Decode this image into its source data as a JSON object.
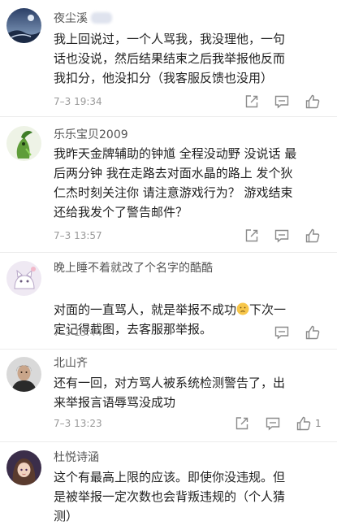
{
  "colors": {
    "text_primary": "#222222",
    "text_username": "#555555",
    "text_meta": "#999999",
    "divider": "#ececec",
    "icon": "#8a8a8a"
  },
  "comments": [
    {
      "username": "夜尘溪",
      "avatar_icon": "avatar-night-scene",
      "body": "我上回说过，一个人骂我，我没理他，一句\n话也没说，然后结果结束之后我举报他反而\n我扣分，他没扣分（我客服反馈也没用）",
      "timestamp": "7–3 19:34",
      "actions": [
        "share-icon",
        "comment-icon",
        "like-icon"
      ]
    },
    {
      "username": "乐乐宝贝2009",
      "avatar_icon": "avatar-green-character",
      "body": "我昨天金牌辅助的钟馗 全程没动野 没说话 最\n后两分钟 我在走路去对面水晶的路上 发个狄\n仁杰时刻关注你 请注意游戏行为？ 游戏结束\n还给我发个了警告邮件？",
      "timestamp": "7–3 13:57",
      "actions": [
        "share-icon",
        "comment-icon",
        "like-icon"
      ]
    },
    {
      "username": "晚上睡不着就改了个名字的酷酷",
      "avatar_icon": "avatar-cat-illustration",
      "body_line1_before": "对面的一直骂人，就是举报不成功",
      "emoji_icon": "sad-face-emoji-icon",
      "body_line1_after": "下次一",
      "body_line2": "定记得截图，去客服那举报。",
      "timestamp": "7–3 13:44",
      "actions": [
        "comment-icon",
        "like-icon"
      ]
    },
    {
      "username": "北山齐",
      "avatar_icon": "avatar-man-portrait",
      "body": "还有一回，对方骂人被系统检测警告了，出\n来举报言语辱骂没成功",
      "timestamp": "7–3 13:23",
      "like_count": "1",
      "actions": [
        "share-icon",
        "comment-icon",
        "like-icon"
      ]
    },
    {
      "username": "杜悦诗涵",
      "avatar_icon": "avatar-anime-girl",
      "body": "这个有最高上限的应该。即使你没违规。但\n是被举报一定次数也会背叛违规的（个人猜\n测）"
    }
  ]
}
